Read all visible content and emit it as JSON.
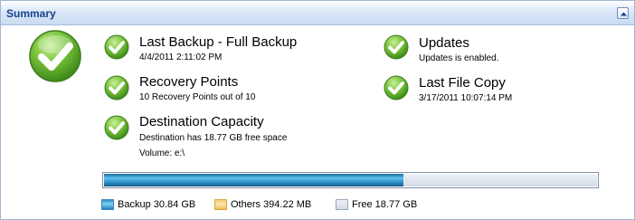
{
  "header": {
    "title": "Summary",
    "collapse_icon": "chevron-up-icon"
  },
  "status": {
    "ok_icon": "checkmark-icon"
  },
  "items": {
    "last_backup": {
      "title": "Last Backup - Full Backup",
      "detail": "4/4/2011 2:11:02 PM"
    },
    "recovery_points": {
      "title": "Recovery Points",
      "detail": "10 Recovery Points out of 10"
    },
    "destination_capacity": {
      "title": "Destination Capacity",
      "detail": "Destination has 18.77 GB free space",
      "detail2": "Volume: e:\\"
    },
    "updates": {
      "title": "Updates",
      "detail": "Updates is enabled."
    },
    "last_file_copy": {
      "title": "Last File Copy",
      "detail": "3/17/2011 10:07:14 PM"
    }
  },
  "capacity": {
    "used_fraction_backup": 0.6,
    "used_fraction_others": 0.008,
    "free_fraction": 0.392
  },
  "legend": [
    {
      "label": "Backup 30.84 GB",
      "color": "#3a9fd8"
    },
    {
      "label": "Others  394.22 MB",
      "color": "#f7cf7c"
    },
    {
      "label": "Free  18.77 GB",
      "color": "#dce3ec"
    }
  ],
  "colors": {
    "accent": "#15428b",
    "check_green": "#5aa82c"
  }
}
